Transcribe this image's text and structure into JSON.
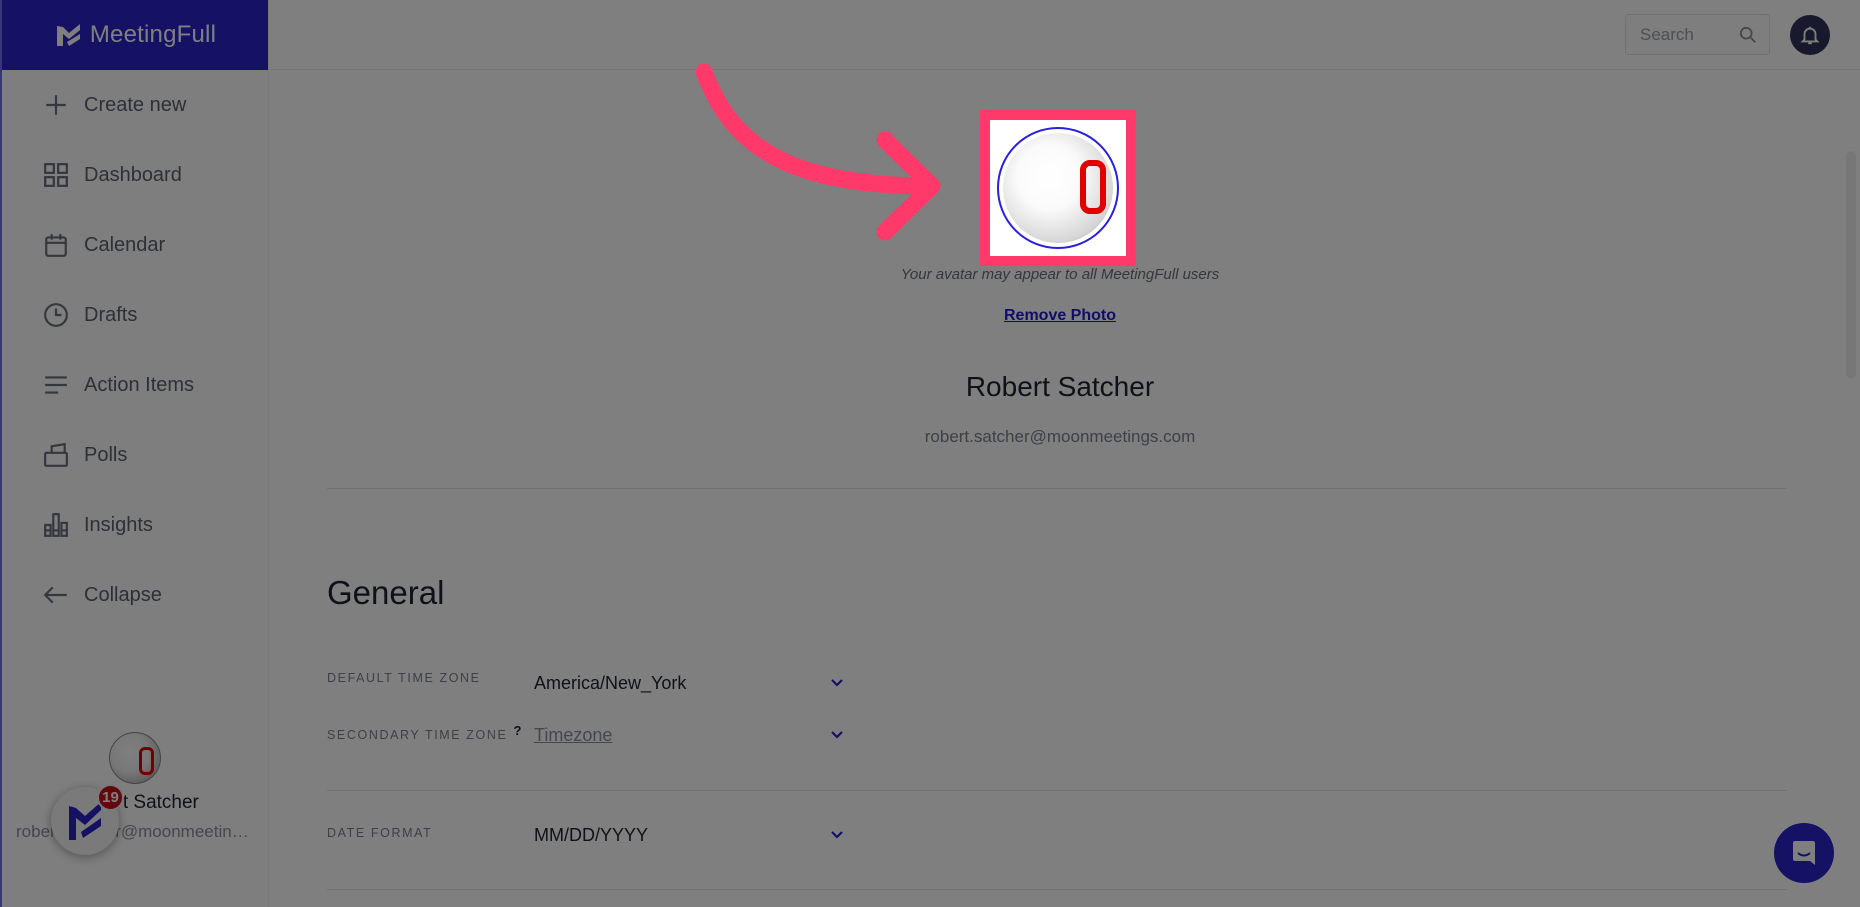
{
  "app": {
    "name": "MeetingFull"
  },
  "sidebar": {
    "items": [
      {
        "label": "Create new",
        "icon": "plus-icon"
      },
      {
        "label": "Dashboard",
        "icon": "grid-icon"
      },
      {
        "label": "Calendar",
        "icon": "calendar-icon"
      },
      {
        "label": "Drafts",
        "icon": "clock-icon"
      },
      {
        "label": "Action Items",
        "icon": "list-icon"
      },
      {
        "label": "Polls",
        "icon": "ballot-box-icon"
      },
      {
        "label": "Insights",
        "icon": "bar-chart-icon"
      },
      {
        "label": "Collapse",
        "icon": "arrow-left-icon"
      }
    ],
    "profile": {
      "name": "Robert Satcher",
      "email": "robert.satcher@moonmeetings.com"
    },
    "launcher": {
      "badge_count": "19"
    }
  },
  "topbar": {
    "search_placeholder": "Search"
  },
  "profile": {
    "avatar_note": "Your avatar may appear to all MeetingFull users",
    "remove_photo_label": "Remove Photo",
    "name": "Robert Satcher",
    "email": "robert.satcher@moonmeetings.com"
  },
  "general": {
    "title": "General",
    "fields": [
      {
        "label": "Default Time Zone",
        "value": "America/New_York",
        "has_help": false
      },
      {
        "label": "Secondary Time Zone",
        "value": "Timezone",
        "is_placeholder": true,
        "has_help": true,
        "help_mark": "?"
      },
      {
        "label": "Date Format",
        "value": "MM/DD/YYYY",
        "has_help": false
      }
    ]
  },
  "colors": {
    "brand": "#2a22c8",
    "highlight": "#ff3a6a",
    "badge": "#c5101a",
    "link": "#1f1acf"
  }
}
